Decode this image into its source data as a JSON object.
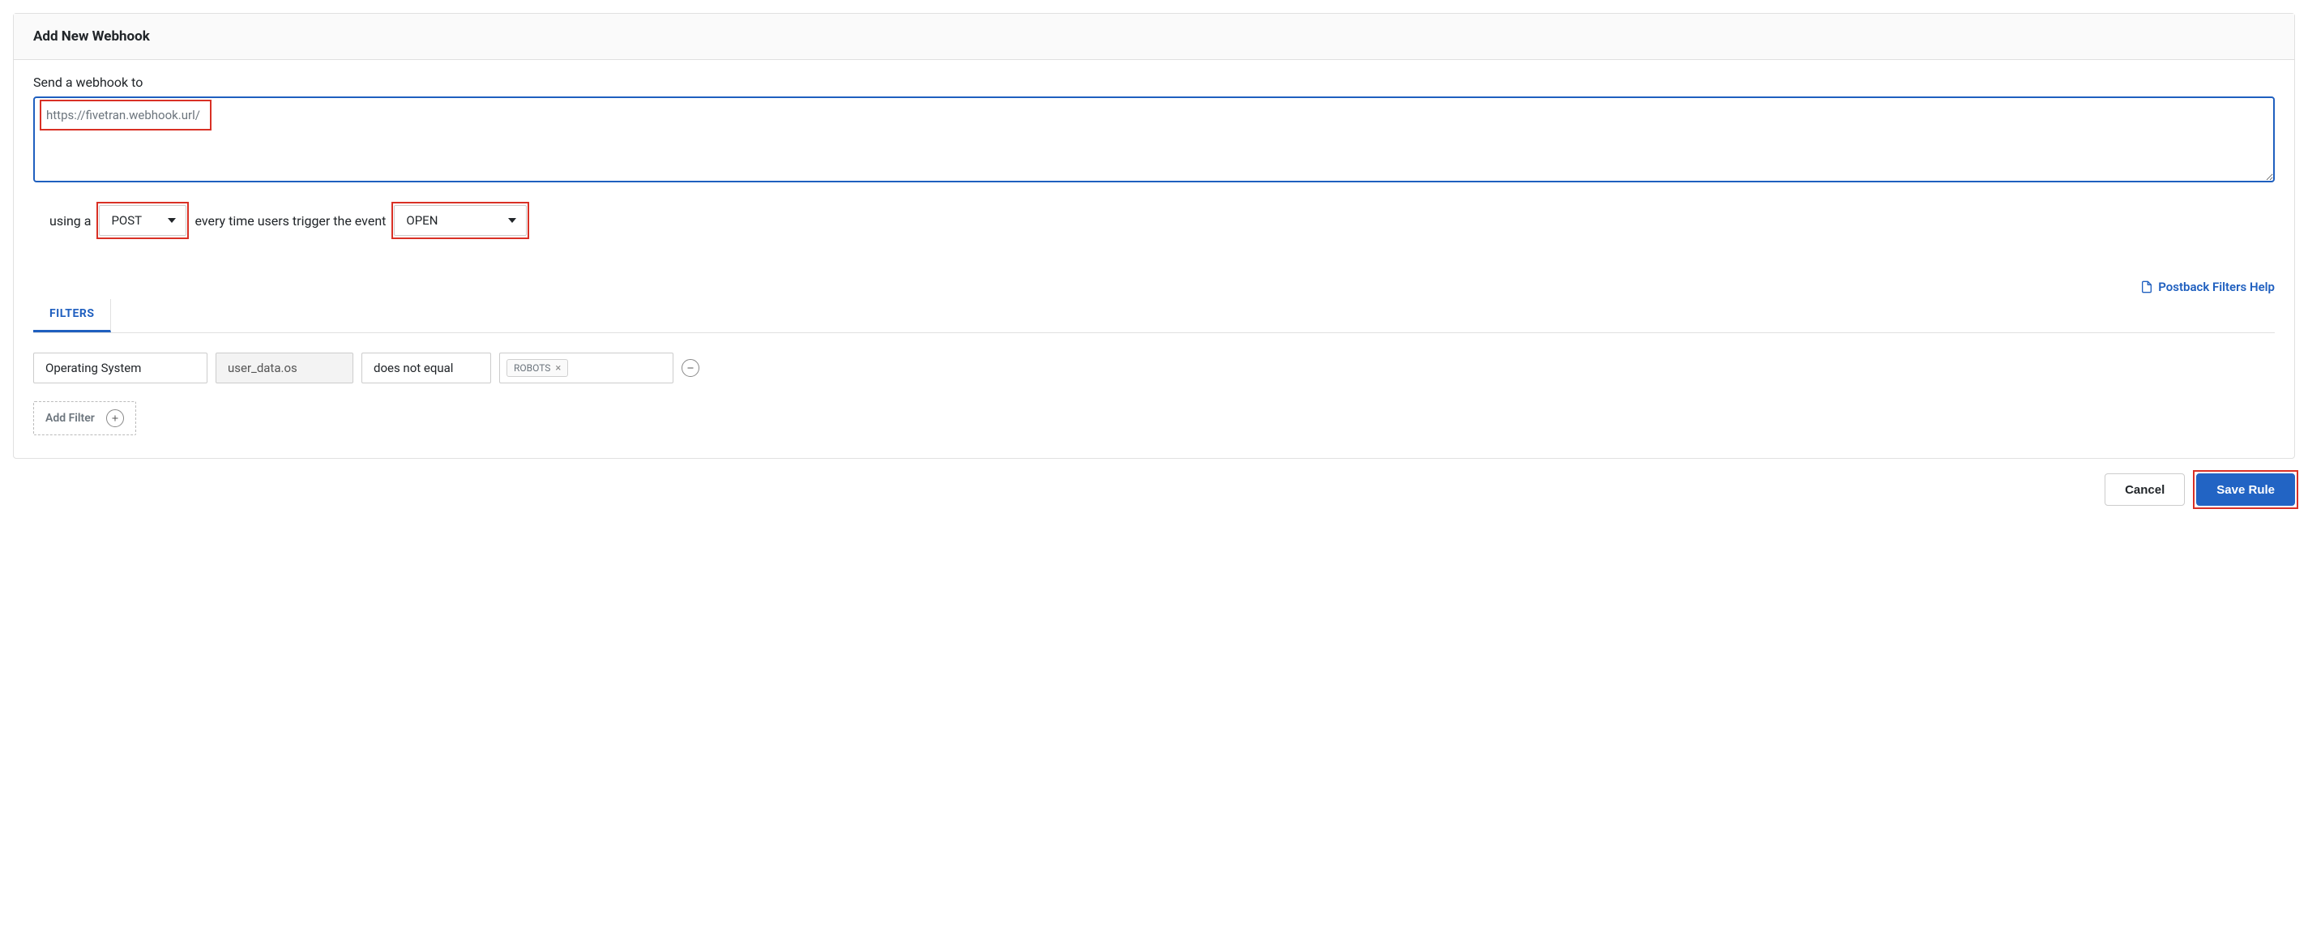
{
  "panel": {
    "title": "Add New Webhook",
    "send_label": "Send a webhook to",
    "url_value": "https://fivetran.webhook.url/",
    "sentence": {
      "using_a": "using a",
      "middle": "every time users trigger the event"
    },
    "method_select": {
      "value": "POST"
    },
    "event_select": {
      "value": "OPEN"
    },
    "help_link": "Postback Filters Help",
    "tabs": {
      "filters": "FILTERS"
    },
    "filter_row": {
      "field_select": "Operating System",
      "field_key": "user_data.os",
      "operator": "does not equal",
      "tag": "ROBOTS"
    },
    "add_filter_label": "Add Filter"
  },
  "footer": {
    "cancel": "Cancel",
    "save": "Save Rule"
  }
}
